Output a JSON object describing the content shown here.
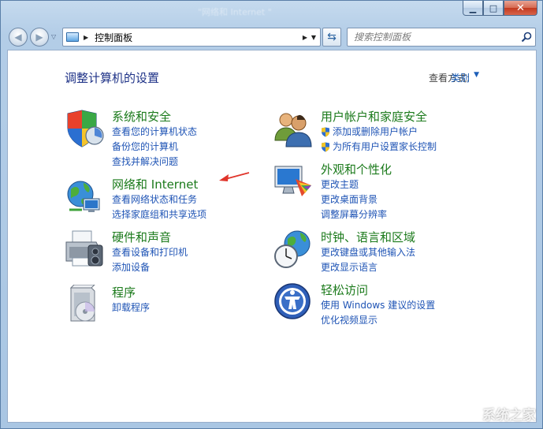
{
  "window": {
    "title_ghost": "\"网络和 Internet \""
  },
  "address_bar": {
    "path": "控制面板",
    "search_placeholder": "搜索控制面板"
  },
  "header": {
    "title": "调整计算机的设置",
    "view_by_label": "查看方式:",
    "view_by_value": "类别"
  },
  "categories": [
    {
      "title": "系统和安全",
      "links": [
        "查看您的计算机状态",
        "备份您的计算机",
        "查找并解决问题"
      ]
    },
    {
      "title": "网络和 Internet",
      "links": [
        "查看网络状态和任务",
        "选择家庭组和共享选项"
      ]
    },
    {
      "title": "硬件和声音",
      "links": [
        "查看设备和打印机",
        "添加设备"
      ]
    },
    {
      "title": "程序",
      "links": [
        "卸载程序"
      ]
    },
    {
      "title": "用户帐户和家庭安全",
      "links": [
        "添加或删除用户帐户",
        "为所有用户设置家长控制"
      ]
    },
    {
      "title": "外观和个性化",
      "links": [
        "更改主题",
        "更改桌面背景",
        "调整屏幕分辨率"
      ]
    },
    {
      "title": "时钟、语言和区域",
      "links": [
        "更改键盘或其他输入法",
        "更改显示语言"
      ]
    },
    {
      "title": "轻松访问",
      "links": [
        "使用 Windows 建议的设置",
        "优化视频显示"
      ]
    }
  ],
  "watermark": "系统之家",
  "colors": {
    "category_title": "#1b7a1b",
    "link": "#1f54b5",
    "page_title": "#1e3287",
    "annotation_arrow": "#e0342a"
  }
}
